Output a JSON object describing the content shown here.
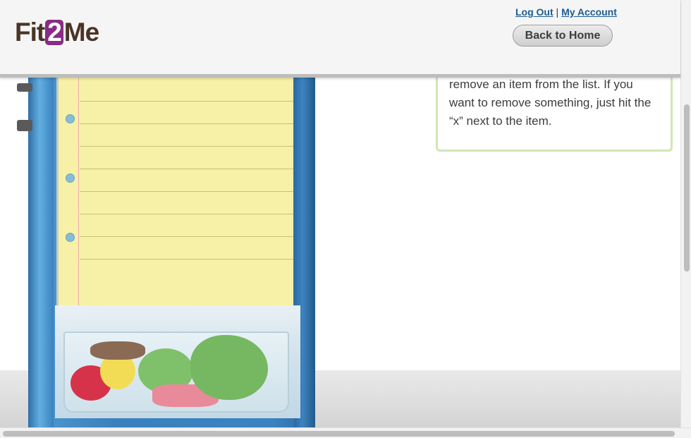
{
  "header": {
    "logo": {
      "prefix": "Fit",
      "highlight": "2",
      "suffix": "Me"
    },
    "links": {
      "logout": "Log Out",
      "separator": "|",
      "account": "My Account"
    },
    "back_button": "Back to Home"
  },
  "info_box": {
    "text": "remove an item from the list. If you want to remove something, just hit the “x” next to the item."
  },
  "colors": {
    "logo_brown": "#4a3426",
    "logo_purple": "#8a2b85",
    "link_blue": "#1d5b93",
    "info_border": "#cfe7b6",
    "fridge_blue": "#3b83c0",
    "notepad_yellow": "#f7f0a7"
  }
}
